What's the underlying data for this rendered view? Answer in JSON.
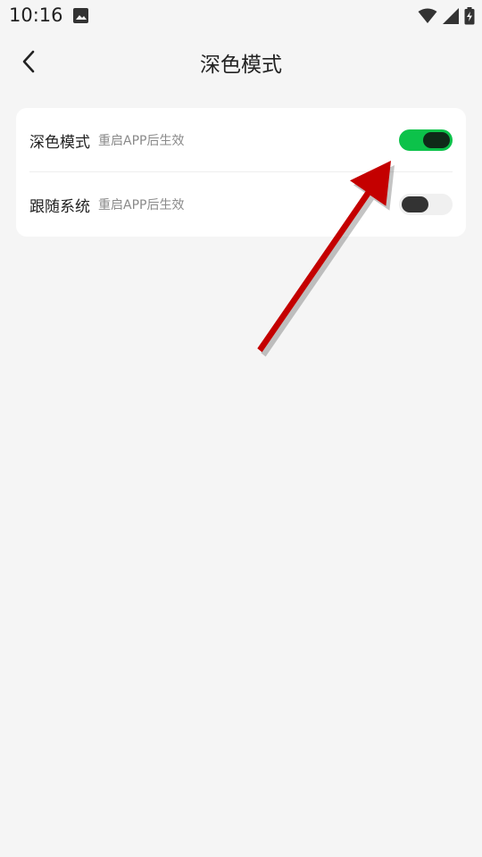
{
  "status_bar": {
    "time": "10:16",
    "icons": [
      "gallery-icon",
      "wifi-icon",
      "signal-icon",
      "battery-charging-icon"
    ]
  },
  "app_bar": {
    "title": "深色模式",
    "back_icon": "chevron-left-icon"
  },
  "settings": [
    {
      "label": "深色模式",
      "hint": "重启APP后生效",
      "enabled": true
    },
    {
      "label": "跟随系统",
      "hint": "重启APP后生效",
      "enabled": false
    }
  ],
  "colors": {
    "background": "#f5f5f5",
    "card": "#ffffff",
    "switch_on": "#0cc24a",
    "switch_off": "#f0f0f0",
    "annotation_arrow": "#c40000"
  }
}
